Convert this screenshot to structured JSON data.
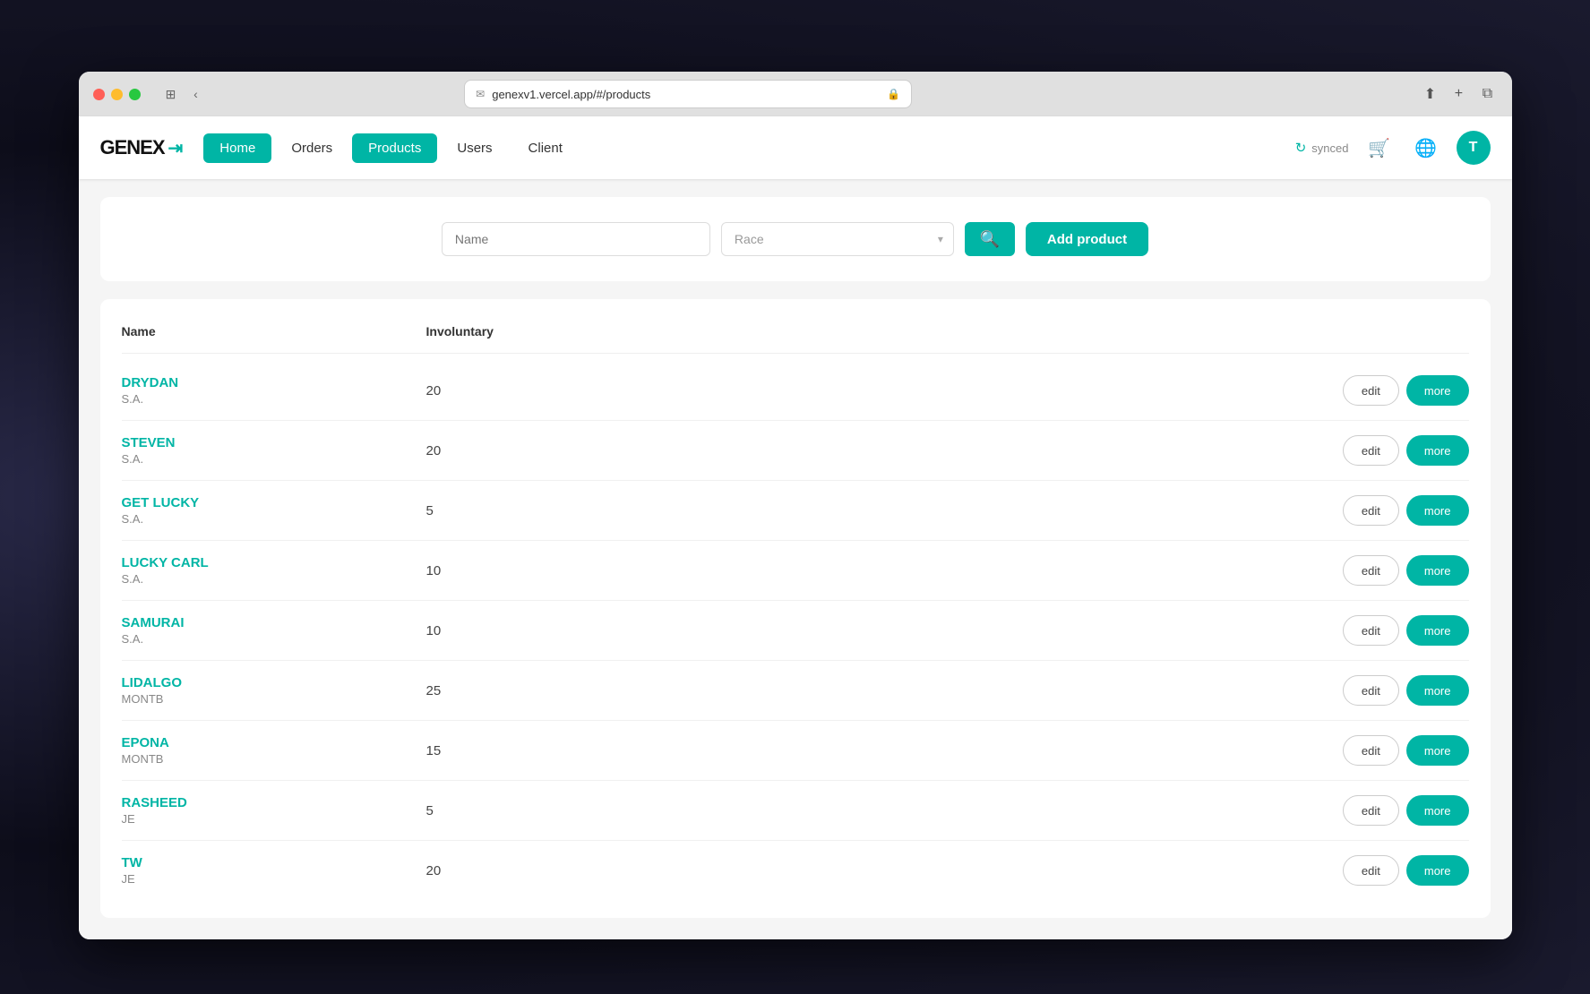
{
  "browser": {
    "url": "genexv1.vercel.app/#/products",
    "url_display": "genexv1.vercel.app/#/products"
  },
  "navbar": {
    "logo_text": "GENEX",
    "synced_label": "synced",
    "avatar_initial": "T",
    "nav_items": [
      {
        "id": "home",
        "label": "Home",
        "active": true
      },
      {
        "id": "orders",
        "label": "Orders",
        "active": false
      },
      {
        "id": "products",
        "label": "Products",
        "active": true
      },
      {
        "id": "users",
        "label": "Users",
        "active": false
      },
      {
        "id": "client",
        "label": "Client",
        "active": false
      }
    ]
  },
  "page": {
    "title": "Products",
    "search_placeholder": "Name",
    "race_placeholder": "Race",
    "add_button_label": "Add product",
    "table": {
      "col_name": "Name",
      "col_involuntary": "Involuntary",
      "rows": [
        {
          "name": "DRYDAN",
          "race": "S.A.",
          "involuntary": "20"
        },
        {
          "name": "STEVEN",
          "race": "S.A.",
          "involuntary": "20"
        },
        {
          "name": "GET LUCKY",
          "race": "S.A.",
          "involuntary": "5"
        },
        {
          "name": "LUCKY CARL",
          "race": "S.A.",
          "involuntary": "10"
        },
        {
          "name": "SAMURAI",
          "race": "S.A.",
          "involuntary": "10"
        },
        {
          "name": "LIDALGO",
          "race": "MONTB",
          "involuntary": "25"
        },
        {
          "name": "EPONA",
          "race": "MONTB",
          "involuntary": "15"
        },
        {
          "name": "RASHEED",
          "race": "JE",
          "involuntary": "5"
        },
        {
          "name": "TW",
          "race": "JE",
          "involuntary": "20"
        }
      ],
      "edit_label": "edit",
      "more_label": "more"
    }
  }
}
